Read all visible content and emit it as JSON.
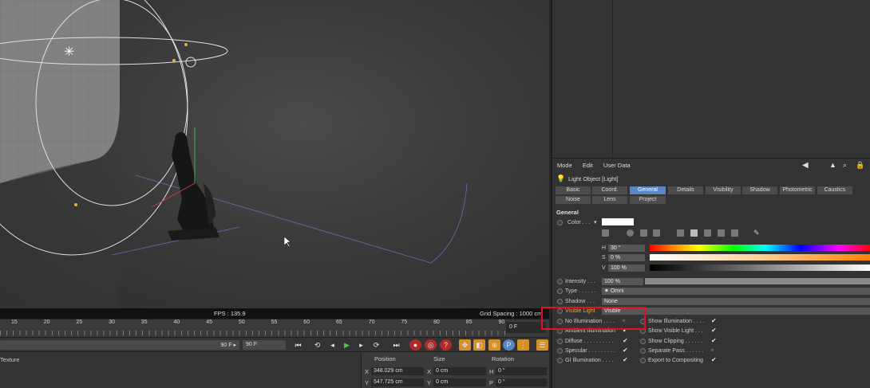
{
  "viewport": {
    "fps": "FPS : 135.9",
    "grid_spacing": "Grid Spacing : 1000 cm"
  },
  "timeline": {
    "ticks": [
      "15",
      "20",
      "25",
      "30",
      "35",
      "40",
      "45",
      "50",
      "55",
      "60",
      "65",
      "70",
      "75",
      "80",
      "85",
      "90"
    ],
    "current_frame": "0 F"
  },
  "transport": {
    "end_frame_a": "90 F",
    "end_frame_b": "90 F"
  },
  "bottom": {
    "material_label": "Texture",
    "headers": {
      "position": "Position",
      "size": "Size",
      "rotation": "Rotation"
    },
    "rows": [
      {
        "axis": "X",
        "pos": "348.029 cm",
        "saxis": "X",
        "size": "0 cm",
        "raxis": "H",
        "rot": "0 °"
      },
      {
        "axis": "Y",
        "pos": "547.725 cm",
        "saxis": "Y",
        "size": "0 cm",
        "raxis": "P",
        "rot": "0 °"
      }
    ]
  },
  "attributes": {
    "menu": [
      "Mode",
      "Edit",
      "User Data"
    ],
    "object_title": "Light Object [Light]",
    "tabs_row1": [
      "Basic",
      "Coord.",
      "General",
      "Details",
      "Visibility",
      "Shadow",
      "Photometric",
      "Caustics"
    ],
    "tabs_row2": [
      "Noise",
      "Lens",
      "Project"
    ],
    "active_tab": "General",
    "section": "General",
    "color_label": "Color . . .",
    "hsv": [
      {
        "label": "H",
        "value": "30 °"
      },
      {
        "label": "S",
        "value": "0 %"
      },
      {
        "label": "V",
        "value": "100 %"
      }
    ],
    "intensity_label": "Intensity . . .",
    "intensity_value": "100 %",
    "type_label": "Type . . . . . .",
    "type_value": "Omni",
    "shadow_label": "Shadow . . .",
    "shadow_value": "None",
    "visible_light_label": "Visible Light",
    "visible_light_value": "Visible",
    "left_options": [
      {
        "label": "No Illumination . . . .",
        "checked": false
      },
      {
        "label": "Ambient Illumination",
        "checked": true
      },
      {
        "label": "Diffuse . . . . . . . . . .",
        "checked": true
      },
      {
        "label": "Specular . . . . . . . . .",
        "checked": true
      },
      {
        "label": "GI Illumination . . . .",
        "checked": true
      }
    ],
    "right_options": [
      {
        "label": "Show Illumination . . . .",
        "checked": true
      },
      {
        "label": "Show Visible Light . . .",
        "checked": true
      },
      {
        "label": "Show Clipping . . . . . .",
        "checked": true
      },
      {
        "label": "Separate Pass . . . . . .",
        "checked": false
      },
      {
        "label": "Export to Compositing",
        "checked": true
      }
    ],
    "colors": {
      "accent_tab": "#5a86c2",
      "highlight_box": "#e0141b",
      "visible_light_label": "#e8a23b"
    }
  }
}
